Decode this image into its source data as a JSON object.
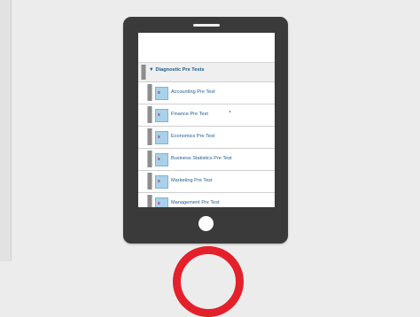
{
  "section": {
    "title": "Diagnostic Pre Tests",
    "caret_glyph": "▼"
  },
  "items": [
    {
      "label": "Accounting Pre Test",
      "icon": "file-icon"
    },
    {
      "label": "Finance Pre Test",
      "icon": "file-icon"
    },
    {
      "label": "Economics Pre Test",
      "icon": "file-icon"
    },
    {
      "label": "Business Statistics Pre Test",
      "icon": "file-icon"
    },
    {
      "label": "Marketing Pre Test",
      "icon": "file-icon"
    },
    {
      "label": "Management Pre Test",
      "icon": "file-icon"
    }
  ],
  "colors": {
    "link": "#1f5a8f",
    "tablet": "#3a3a3a",
    "icon_bg": "#a9d1ea",
    "accent_red": "#e4202a"
  }
}
